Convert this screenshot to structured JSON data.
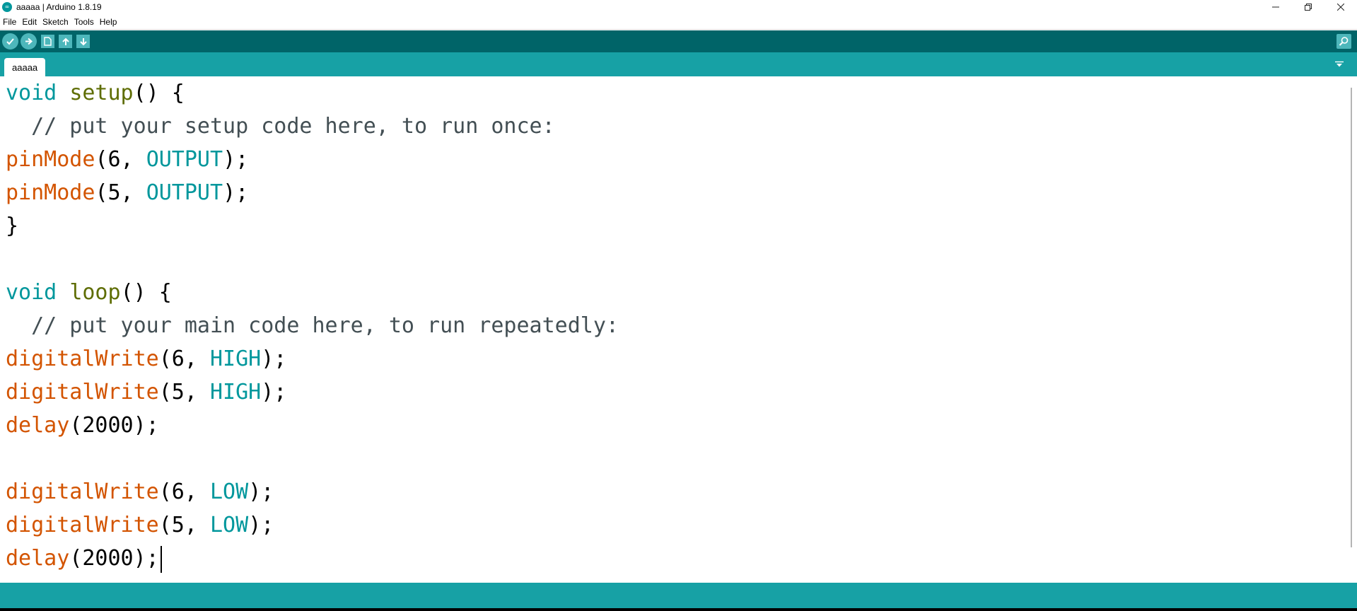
{
  "window": {
    "title": "aaaaa | Arduino 1.8.19",
    "icon": "arduino-logo-icon",
    "controls": [
      "minimize-icon",
      "restore-icon",
      "close-icon"
    ]
  },
  "menu": {
    "items": [
      "File",
      "Edit",
      "Sketch",
      "Tools",
      "Help"
    ]
  },
  "toolbar": {
    "buttons": [
      "verify-icon",
      "upload-icon",
      "new-icon",
      "open-icon",
      "save-icon"
    ],
    "right_button": "serial-monitor-icon"
  },
  "tabs": {
    "items": [
      "aaaaa"
    ],
    "menu_icon": "tab-dropdown-icon"
  },
  "colors": {
    "toolbar": "#006468",
    "tabstrip": "#17a1a5",
    "keyword": "#00979c",
    "function_name": "#5e6d03",
    "builtin_call": "#d35400",
    "constant": "#00979c",
    "comment": "#434f54"
  },
  "code": {
    "lines": [
      [
        {
          "t": "void",
          "c": "kw"
        },
        {
          "t": " ",
          "c": "plain"
        },
        {
          "t": "setup",
          "c": "fn"
        },
        {
          "t": "() {",
          "c": "plain"
        }
      ],
      [
        {
          "t": "  // put your setup code here, to run once:",
          "c": "com"
        }
      ],
      [
        {
          "t": "pinMode",
          "c": "call"
        },
        {
          "t": "(6, ",
          "c": "plain"
        },
        {
          "t": "OUTPUT",
          "c": "const"
        },
        {
          "t": ");",
          "c": "plain"
        }
      ],
      [
        {
          "t": "pinMode",
          "c": "call"
        },
        {
          "t": "(5, ",
          "c": "plain"
        },
        {
          "t": "OUTPUT",
          "c": "const"
        },
        {
          "t": ");",
          "c": "plain"
        }
      ],
      [
        {
          "t": "}",
          "c": "plain"
        }
      ],
      [],
      [
        {
          "t": "void",
          "c": "kw"
        },
        {
          "t": " ",
          "c": "plain"
        },
        {
          "t": "loop",
          "c": "fn"
        },
        {
          "t": "() {",
          "c": "plain"
        }
      ],
      [
        {
          "t": "  // put your main code here, to run repeatedly:",
          "c": "com"
        }
      ],
      [
        {
          "t": "digitalWrite",
          "c": "call"
        },
        {
          "t": "(6, ",
          "c": "plain"
        },
        {
          "t": "HIGH",
          "c": "const"
        },
        {
          "t": ");",
          "c": "plain"
        }
      ],
      [
        {
          "t": "digitalWrite",
          "c": "call"
        },
        {
          "t": "(5, ",
          "c": "plain"
        },
        {
          "t": "HIGH",
          "c": "const"
        },
        {
          "t": ");",
          "c": "plain"
        }
      ],
      [
        {
          "t": "delay",
          "c": "call"
        },
        {
          "t": "(2000);",
          "c": "plain"
        }
      ],
      [],
      [
        {
          "t": "digitalWrite",
          "c": "call"
        },
        {
          "t": "(6, ",
          "c": "plain"
        },
        {
          "t": "LOW",
          "c": "const"
        },
        {
          "t": ");",
          "c": "plain"
        }
      ],
      [
        {
          "t": "digitalWrite",
          "c": "call"
        },
        {
          "t": "(5, ",
          "c": "plain"
        },
        {
          "t": "LOW",
          "c": "const"
        },
        {
          "t": ");",
          "c": "plain"
        }
      ],
      [
        {
          "t": "delay",
          "c": "call"
        },
        {
          "t": "(2000);",
          "c": "plain"
        }
      ]
    ],
    "caret_line": 14
  }
}
